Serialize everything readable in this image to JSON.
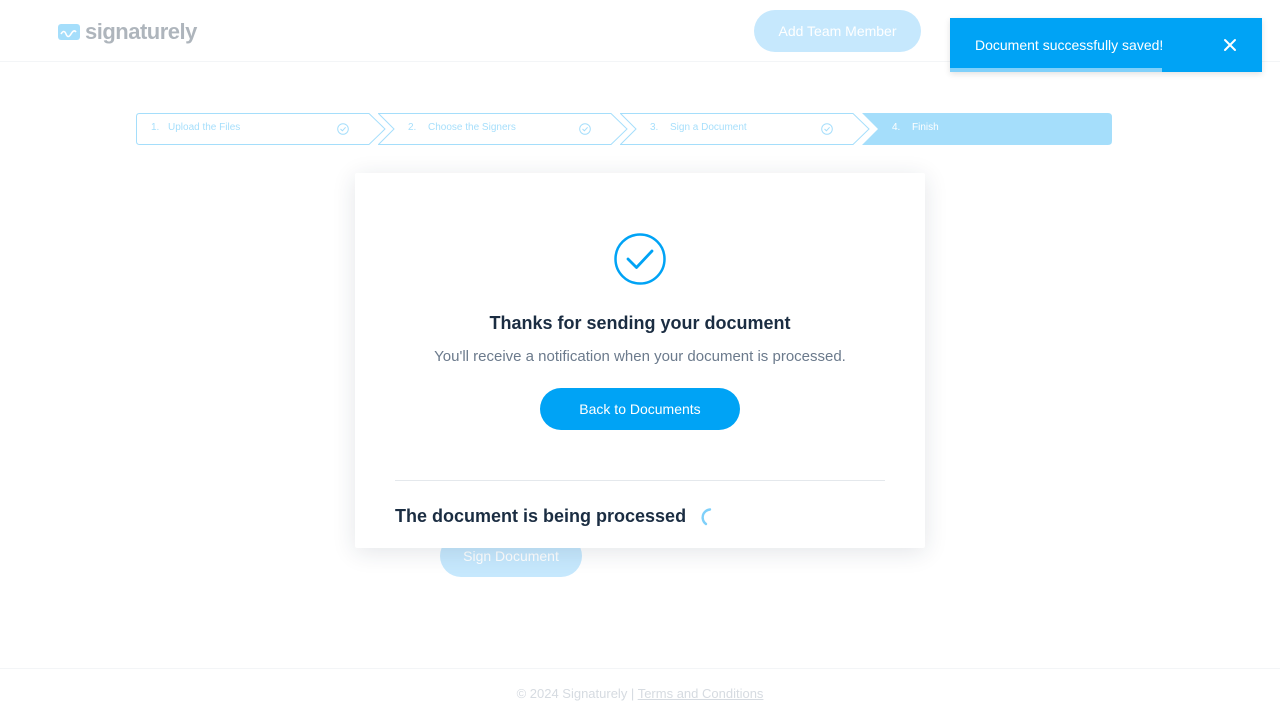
{
  "header": {
    "logo_text": "signaturely",
    "add_team_member_label": "Add Team Member"
  },
  "toast": {
    "message": "Document successfully saved!",
    "progress": 0.68,
    "close_icon": "close-icon"
  },
  "stepper": {
    "steps": [
      {
        "number": "1.",
        "label": "Upload the Files",
        "completed": true
      },
      {
        "number": "2.",
        "label": "Choose the Signers",
        "completed": true
      },
      {
        "number": "3.",
        "label": "Sign a Document",
        "completed": true
      },
      {
        "number": "4.",
        "label": "Finish",
        "active": true
      }
    ]
  },
  "background": {
    "sign_document_label": "Sign Document"
  },
  "modal": {
    "icon": "checkmark-circle-icon",
    "title": "Thanks for sending your document",
    "subtitle": "You'll receive a notification when your document is processed.",
    "back_button_label": "Back to Documents",
    "processing_text": "The document is being processed"
  },
  "footer": {
    "copyright": "© 2024 Signaturely | ",
    "terms_label": "Terms and Conditions"
  },
  "colors": {
    "accent": "#00a3f5",
    "heading": "#1b2d42",
    "muted_text": "#6b7a8c"
  }
}
